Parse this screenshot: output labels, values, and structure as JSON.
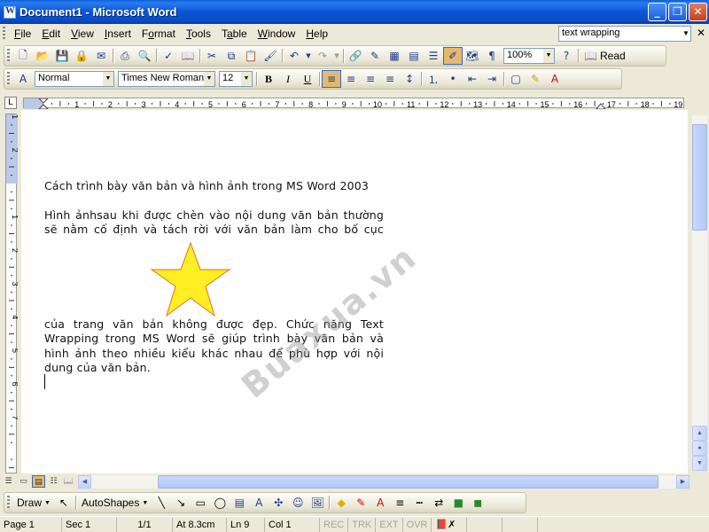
{
  "window": {
    "title": "Document1 - Microsoft Word"
  },
  "menu": {
    "items": [
      {
        "key": "F",
        "rest": "ile"
      },
      {
        "key": "E",
        "rest": "dit"
      },
      {
        "key": "V",
        "rest": "iew"
      },
      {
        "key": "I",
        "rest": "nsert"
      },
      {
        "key": "",
        "pre": "F",
        "k2": "o",
        "rest": "rmat"
      },
      {
        "key": "T",
        "rest": "ools"
      },
      {
        "key": "",
        "pre": "T",
        "k2": "a",
        "rest": "ble"
      },
      {
        "key": "W",
        "rest": "indow"
      },
      {
        "key": "H",
        "rest": "elp"
      }
    ],
    "help_search_value": "text wrapping"
  },
  "standard_toolbar": {
    "zoom": "100%",
    "read_label": "Read"
  },
  "formatting_toolbar": {
    "style": "Normal",
    "font": "Times New Roman",
    "size": "12",
    "bold": "B",
    "italic": "I",
    "underline": "U"
  },
  "ruler": {
    "numbers": [
      "1",
      "2",
      "3",
      "4",
      "5",
      "6",
      "7",
      "8",
      "9",
      "10",
      "11",
      "12",
      "13",
      "14",
      "15",
      "16",
      "17",
      "18",
      "19"
    ],
    "vnumbers": [
      "1",
      "2",
      "1",
      "2",
      "3",
      "4",
      "5",
      "6",
      "7"
    ]
  },
  "document": {
    "heading": "Cách trình bày văn bản và hình ảnh trong MS Word 2003",
    "para1_lines": [
      "Hình ảnhsau khi được chèn vào nội dung văn bản thường",
      "sẽ nằm cố định và tách rời với văn bản làm cho bố cục"
    ],
    "para2_lines": [
      "của trang văn bản không được đẹp. Chức năng Text",
      "Wrapping trong MS Word sẽ giúp trình bày văn bản và",
      "hình ảnh theo nhiều kiểu khác nhau để phù hợp với nội",
      "dung của văn bản."
    ],
    "watermark": "Buaxua.vn",
    "star_fill": "#ffee22",
    "star_stroke": "#e07020"
  },
  "drawing_toolbar": {
    "draw_label": "Draw",
    "autoshapes_label": "AutoShapes"
  },
  "status": {
    "page": "Page 1",
    "sec": "Sec 1",
    "pages": "1/1",
    "at": "At 8.3cm",
    "ln": "Ln 9",
    "col": "Col 1",
    "rec": "REC",
    "trk": "TRK",
    "ext": "EXT",
    "ovr": "OVR"
  }
}
